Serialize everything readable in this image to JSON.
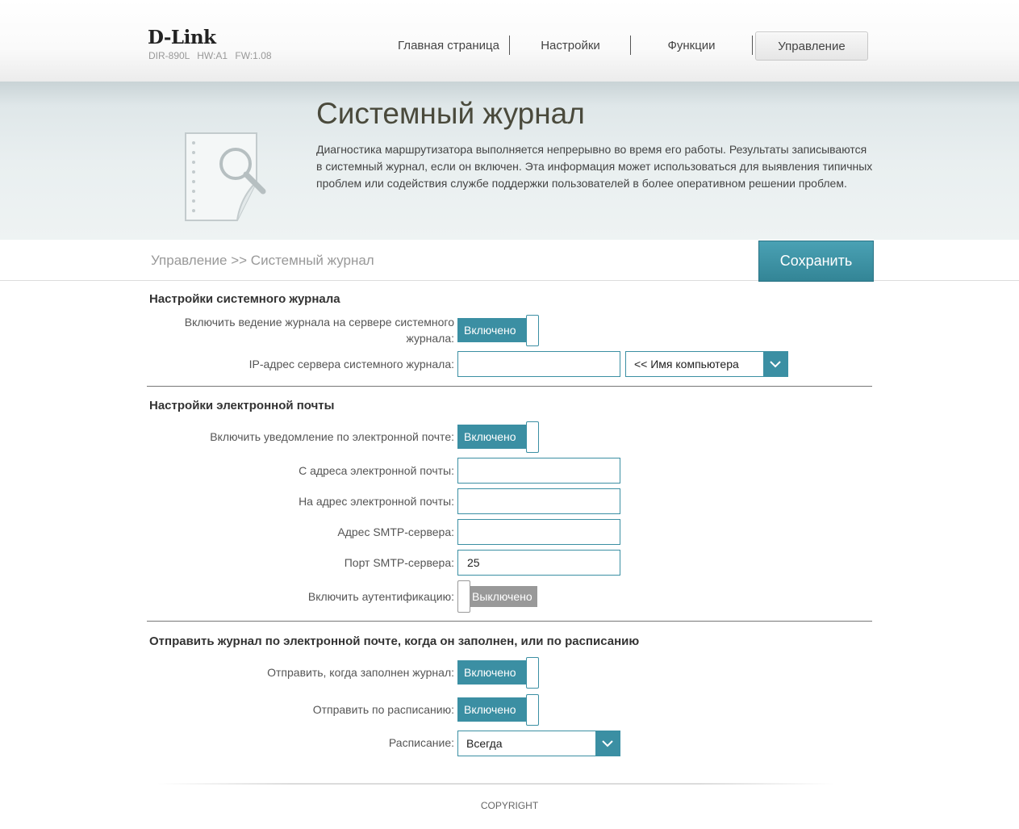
{
  "brand": {
    "logo": "D-Link",
    "model": "DIR-890L",
    "hw": "HW:A1",
    "fw": "FW:1.08"
  },
  "nav": {
    "home": "Главная страница",
    "settings": "Настройки",
    "features": "Функции",
    "management": "Управление"
  },
  "banner": {
    "title": "Системный журнал",
    "description": "Диагностика маршрутизатора выполняется непрерывно во время его работы. Результаты записываются в системный журнал, если он включен. Эта информация может использоваться для выявления типичных проблем или содействия службе поддержки пользователей в более оперативном решении проблем."
  },
  "breadcrumb": "Управление >> Системный журнал",
  "save_label": "Сохранить",
  "syslog": {
    "title": "Настройки системного журнала",
    "enable_label": "Включить ведение журнала на сервере системного журнала:",
    "enable_state": "Включено",
    "ip_label": "IP-адрес сервера системного журнала:",
    "ip_value": "",
    "computer_select": "<< Имя компьютера"
  },
  "email": {
    "title": "Настройки электронной почты",
    "notify_label": "Включить уведомление по электронной почте:",
    "notify_state": "Включено",
    "from_label": "С адреса электронной почты:",
    "from_value": "",
    "to_label": "На адрес электронной почты:",
    "to_value": "",
    "smtp_label": "Адрес SMTP-сервера:",
    "smtp_value": "",
    "port_label": "Порт SMTP-сервера:",
    "port_value": "25",
    "auth_label": "Включить аутентификацию:",
    "auth_state": "Выключено"
  },
  "send": {
    "title": "Отправить журнал по электронной почте, когда он заполнен, или по расписанию",
    "full_label": "Отправить, когда заполнен журнал:",
    "full_state": "Включено",
    "schedule_toggle_label": "Отправить по расписанию:",
    "schedule_toggle_state": "Включено",
    "schedule_label": "Расписание:",
    "schedule_value": "Всегда"
  },
  "footer": {
    "copyright": "COPYRIGHT"
  },
  "colors": {
    "accent": "#3b8fa3",
    "off": "#999999"
  }
}
